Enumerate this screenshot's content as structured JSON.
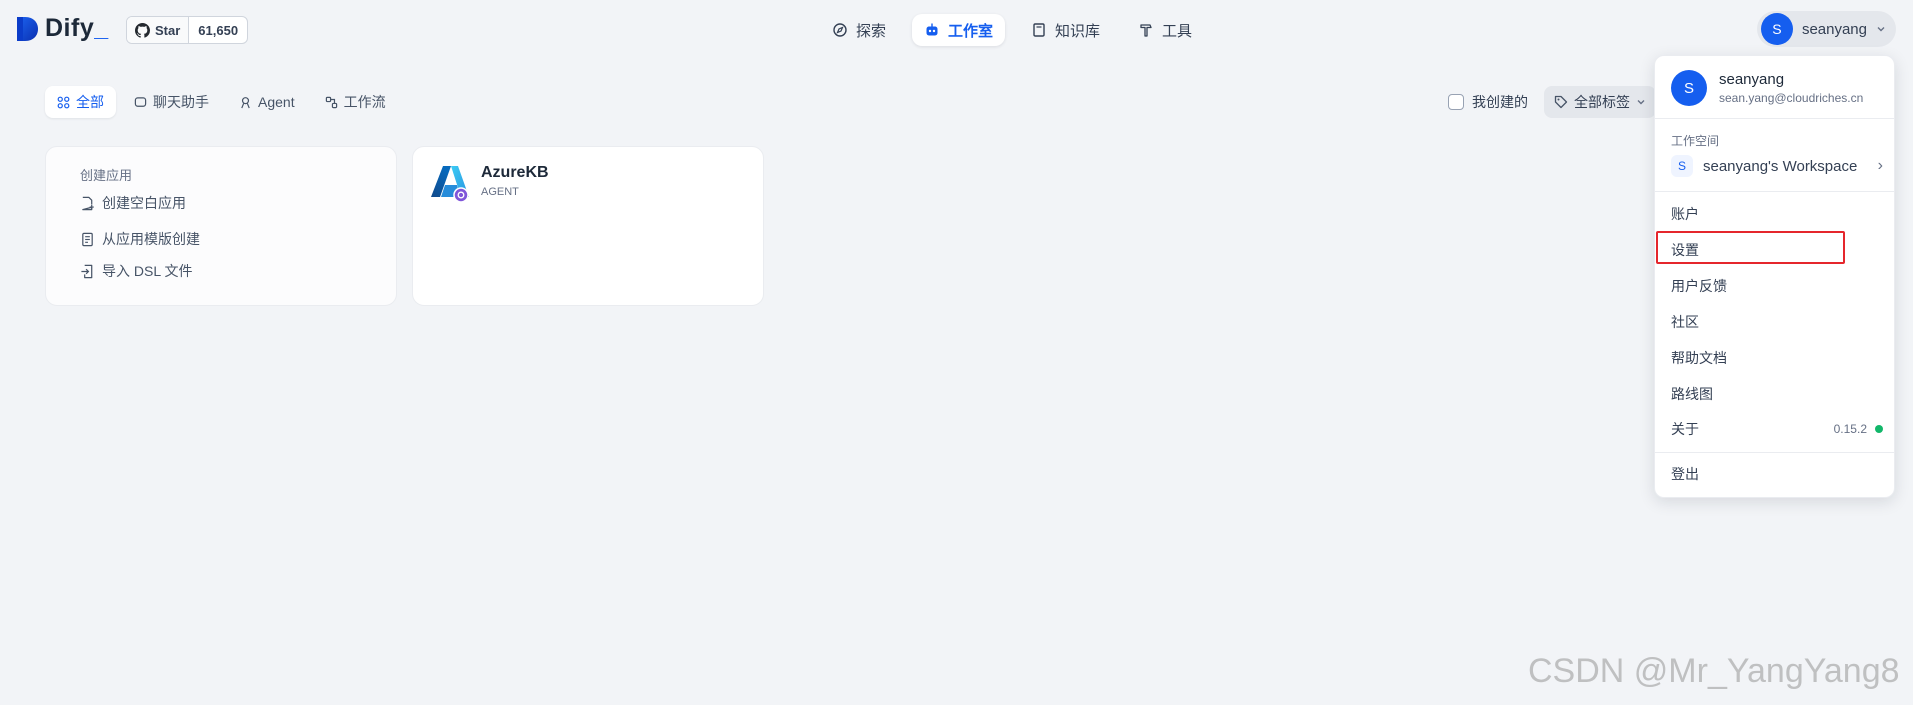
{
  "brand": {
    "name": "Dify",
    "accent": "#155eef"
  },
  "github": {
    "star_label": "Star",
    "star_count": "61,650"
  },
  "nav": {
    "items": [
      {
        "label": "探索",
        "icon": "compass-icon",
        "active": false
      },
      {
        "label": "工作室",
        "icon": "robot-icon",
        "active": true
      },
      {
        "label": "知识库",
        "icon": "book-icon",
        "active": false
      },
      {
        "label": "工具",
        "icon": "hammer-icon",
        "active": false
      }
    ]
  },
  "user": {
    "initial": "S",
    "name": "seanyang",
    "email": "sean.yang@cloudriches.cn"
  },
  "tabs": [
    {
      "label": "全部",
      "active": true
    },
    {
      "label": "聊天助手",
      "active": false
    },
    {
      "label": "Agent",
      "active": false
    },
    {
      "label": "工作流",
      "active": false
    }
  ],
  "filters": {
    "mine_label": "我创建的",
    "tag_label": "全部标签"
  },
  "create_card": {
    "title": "创建应用",
    "items": [
      {
        "label": "创建空白应用",
        "icon": "file-plus-icon"
      },
      {
        "label": "从应用模版创建",
        "icon": "template-icon"
      },
      {
        "label": "导入 DSL 文件",
        "icon": "import-icon"
      }
    ]
  },
  "apps": [
    {
      "name": "AzureKB",
      "type": "AGENT"
    }
  ],
  "dropdown": {
    "workspace_label": "工作空间",
    "workspace": {
      "initial": "S",
      "name": "seanyang's Workspace"
    },
    "items": {
      "account": "账户",
      "settings": "设置",
      "feedback": "用户反馈",
      "community": "社区",
      "help": "帮助文档",
      "roadmap": "路线图",
      "about": "关于",
      "version": "0.15.2",
      "logout": "登出"
    }
  },
  "watermark": "CSDN @Mr_YangYang8"
}
